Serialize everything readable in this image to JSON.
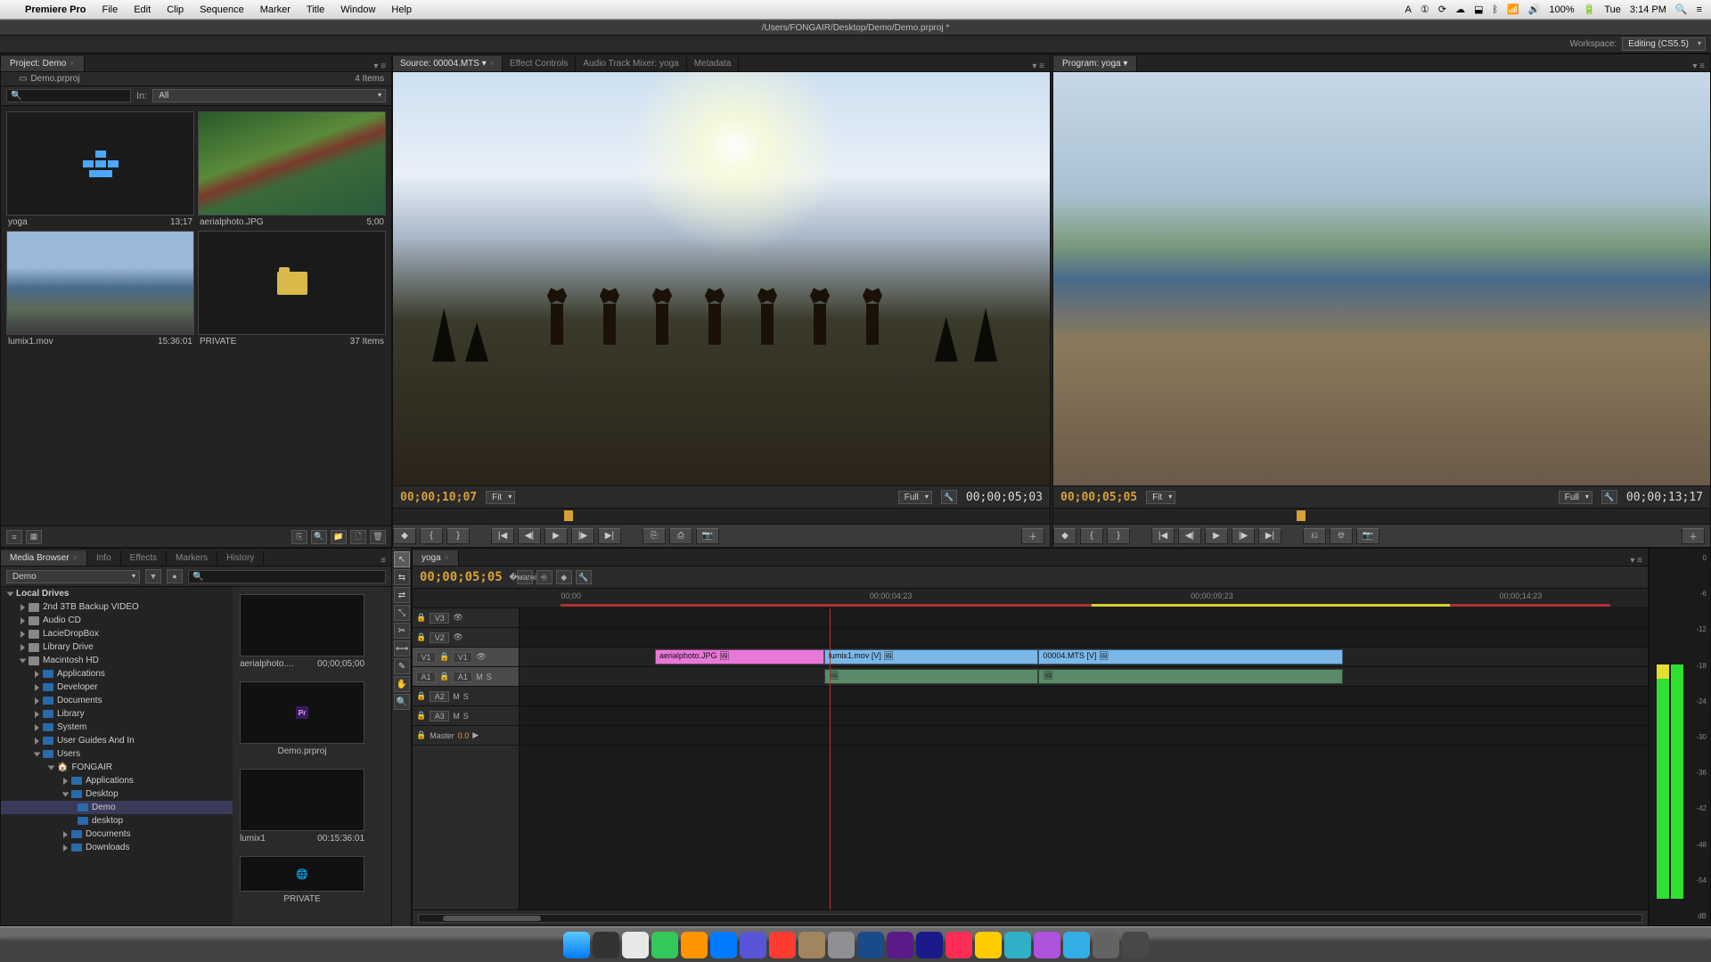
{
  "mac_menu": {
    "app_name": "Premiere Pro",
    "items": [
      "File",
      "Edit",
      "Clip",
      "Sequence",
      "Marker",
      "Title",
      "Window",
      "Help"
    ],
    "right": {
      "battery": "100%",
      "day": "Tue",
      "time": "3:14 PM"
    }
  },
  "title_bar": "/Users/FONGAIR/Desktop/Demo/Demo.prproj *",
  "workspace": {
    "label": "Workspace:",
    "value": "Editing (CS5.5)"
  },
  "project": {
    "tab": "Project: Demo",
    "file": "Demo.prproj",
    "count": "4 Items",
    "search_in_label": "In:",
    "search_in_value": "All",
    "items": [
      {
        "name": "yoga",
        "dur": "13;17",
        "type": "sequence"
      },
      {
        "name": "aerialphoto.JPG",
        "dur": "5;00",
        "type": "still"
      },
      {
        "name": "lumix1.mov",
        "dur": "15:36:01",
        "type": "video"
      },
      {
        "name": "PRIVATE",
        "dur": "37 Items",
        "type": "folder"
      }
    ]
  },
  "source": {
    "tabs": [
      "Source: 00004.MTS",
      "Effect Controls",
      "Audio Track Mixer: yoga",
      "Metadata"
    ],
    "tc_left": "00;00;10;07",
    "fit": "Fit",
    "res": "Full",
    "tc_right": "00;00;05;03"
  },
  "program": {
    "tab": "Program: yoga",
    "tc_left": "00;00;05;05",
    "fit": "Fit",
    "res": "Full",
    "tc_right": "00;00;13;17"
  },
  "media_browser": {
    "tabs": [
      "Media Browser",
      "Info",
      "Effects",
      "Markers",
      "History"
    ],
    "dd": "Demo",
    "tree_header": "Local Drives",
    "tree": [
      "2nd 3TB Backup VIDEO",
      "Audio CD",
      "LacieDropBox",
      "Library Drive",
      "Macintosh HD",
      "Applications",
      "Developer",
      "Documents",
      "Library",
      "System",
      "User Guides And In",
      "Users",
      "FONGAIR",
      "Applications",
      "Desktop",
      "Demo",
      "desktop",
      "Documents",
      "Downloads"
    ],
    "items": [
      {
        "name": "aerialphoto....",
        "dur": "00;00;05;00"
      },
      {
        "name": "Demo.prproj",
        "dur": ""
      },
      {
        "name": "lumix1",
        "dur": "00:15:36:01"
      },
      {
        "name": "PRIVATE",
        "dur": ""
      }
    ]
  },
  "timeline": {
    "tab": "yoga",
    "tc": "00;00;05;05",
    "ruler": [
      "00;00",
      "00;00;04;23",
      "00;00;09;23",
      "00;00;14;23"
    ],
    "tracks": {
      "video": [
        "V3",
        "V2",
        "V1"
      ],
      "audio": [
        "A1",
        "A2",
        "A3"
      ],
      "master": "Master",
      "master_val": "0.0"
    },
    "clips": [
      {
        "track": "V1",
        "name": "aerialphoto.JPG 🖼",
        "start": 0,
        "end": 27,
        "class": "pink"
      },
      {
        "track": "V1",
        "name": "lumix1.mov [V] 🖼",
        "start": 27,
        "end": 46,
        "class": "blue"
      },
      {
        "track": "V1",
        "name": "00004.MTS [V] 🖼",
        "start": 46,
        "end": 73,
        "class": "blue"
      },
      {
        "track": "A1",
        "name": "",
        "start": 27,
        "end": 46,
        "class": "audio"
      },
      {
        "track": "A1",
        "name": "",
        "start": 46,
        "end": 73,
        "class": "audio"
      }
    ],
    "playhead_pct": 27.5
  },
  "meters": {
    "scale": [
      "0",
      "-6",
      "-12",
      "-18",
      "-24",
      "-30",
      "-36",
      "-42",
      "-48",
      "-54",
      "dB"
    ]
  },
  "transport_icons": [
    "◆",
    "{",
    "}",
    "",
    "⇤",
    "◀",
    "▶",
    "▶|",
    "⇥",
    "",
    "⎘",
    "⎙",
    "📷"
  ],
  "tools": [
    "↖",
    "⇆",
    "✂",
    "⤡",
    "✎",
    "✋",
    "🔍"
  ]
}
